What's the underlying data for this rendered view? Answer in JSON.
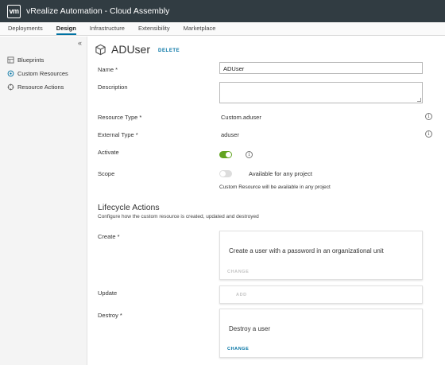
{
  "app": {
    "logo_text": "vm",
    "title": "vRealize Automation - Cloud Assembly"
  },
  "nav": {
    "tabs": [
      "Deployments",
      "Design",
      "Infrastructure",
      "Extensibility",
      "Marketplace"
    ],
    "active": "Design"
  },
  "sidebar": {
    "collapse_glyph": "«",
    "items": [
      {
        "label": "Blueprints",
        "icon": "blueprint-icon"
      },
      {
        "label": "Custom Resources",
        "icon": "custom-resources-icon"
      },
      {
        "label": "Resource Actions",
        "icon": "resource-actions-icon"
      }
    ]
  },
  "page": {
    "title": "ADUser",
    "delete_label": "DELETE",
    "icon": "cube-icon"
  },
  "form": {
    "name": {
      "label": "Name *",
      "value": "ADUser"
    },
    "description": {
      "label": "Description",
      "value": ""
    },
    "resource_type": {
      "label": "Resource Type *",
      "value": "Custom.aduser"
    },
    "external_type": {
      "label": "External Type *",
      "value": "aduser"
    },
    "activate": {
      "label": "Activate",
      "enabled": true
    },
    "scope": {
      "label": "Scope",
      "toggle_label": "Available for any project",
      "enabled": false,
      "helper": "Custom Resource will be available in any project"
    },
    "info_glyph": "i"
  },
  "lifecycle": {
    "title": "Lifecycle Actions",
    "subtitle": "Configure how the custom resource is created, updated and destroyed",
    "create": {
      "label": "Create *",
      "text": "Create a user with a password in an organizational unit",
      "link": "CHANGE"
    },
    "update": {
      "label": "Update",
      "link": "ADD"
    },
    "destroy": {
      "label": "Destroy *",
      "text": "Destroy a user",
      "link": "CHANGE"
    }
  },
  "colors": {
    "topbar": "#313c42",
    "accent": "#0072a3",
    "toggle_on": "#62a420",
    "toggle_off": "#dddddd"
  }
}
